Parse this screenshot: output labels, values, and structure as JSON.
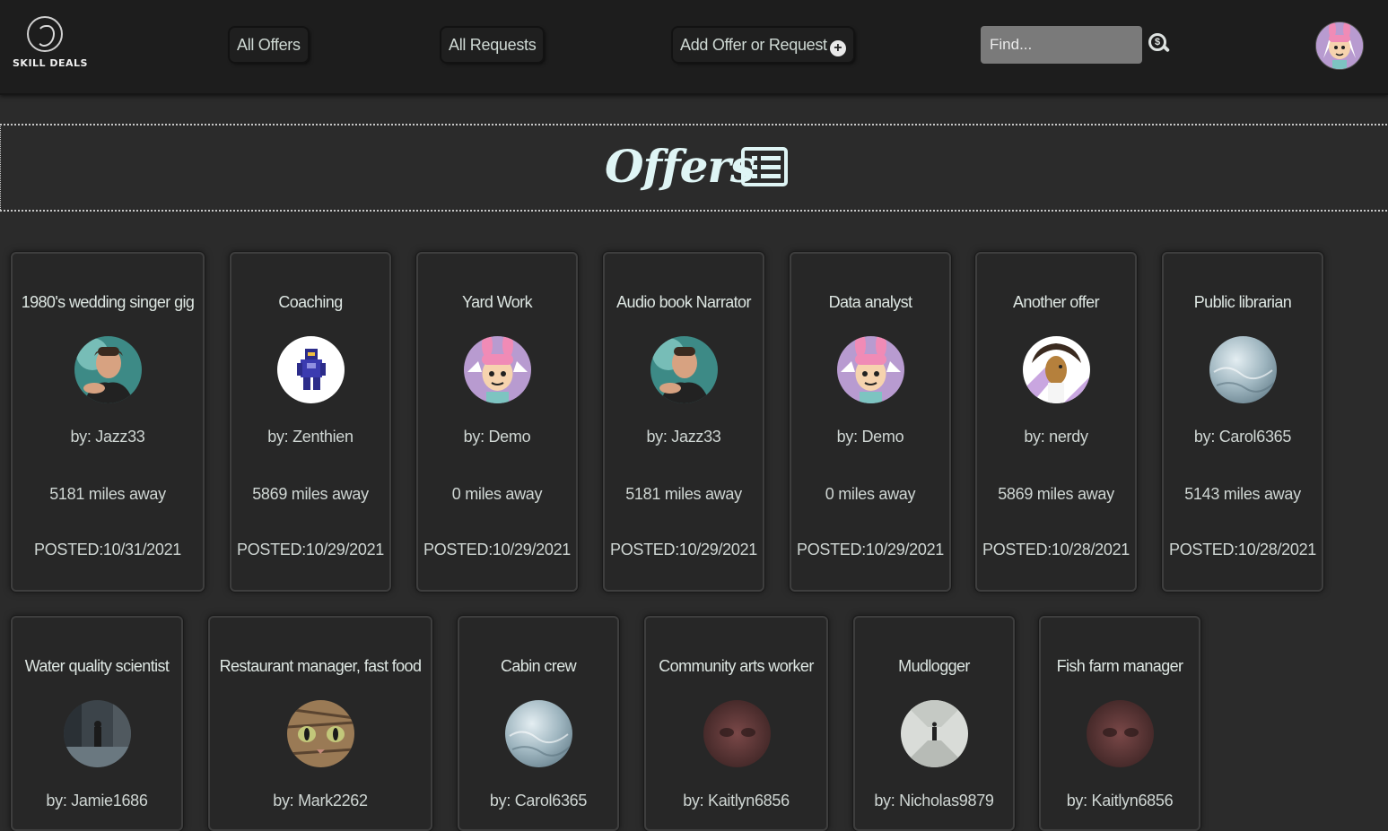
{
  "navbar": {
    "logo_text": "SKILL DEALS",
    "all_offers": "All Offers",
    "all_requests": "All Requests",
    "add_offer_request": "Add Offer or Request",
    "add_icon": "plus-circle-icon",
    "search_placeholder": "Find...",
    "search_icon": "dollar-search-icon"
  },
  "banner": {
    "title": "Offers",
    "icon": "list-icon"
  },
  "colors": {
    "background": "#2b2b2b",
    "navbar": "#1d1d1d",
    "card": "#272727",
    "banner_text": "#dff5f5",
    "search_field": "#7a7a7a"
  },
  "offers": [
    {
      "title": "1980's wedding singer gig",
      "by": "by: Jazz33",
      "distance": "5181 miles away",
      "posted": "POSTED:10/31/2021",
      "avatar": "man-portrait-avatar"
    },
    {
      "title": "Coaching",
      "by": "by: Zenthien",
      "distance": "5869 miles away",
      "posted": "POSTED:10/29/2021",
      "avatar": "pixel-knight-avatar"
    },
    {
      "title": "Yard Work",
      "by": "by: Demo",
      "distance": "0 miles away",
      "posted": "POSTED:10/29/2021",
      "avatar": "bunny-ears-girl-avatar"
    },
    {
      "title": "Audio book Narrator",
      "by": "by: Jazz33",
      "distance": "5181 miles away",
      "posted": "POSTED:10/29/2021",
      "avatar": "man-portrait-avatar"
    },
    {
      "title": "Data analyst",
      "by": "by: Demo",
      "distance": "0 miles away",
      "posted": "POSTED:10/29/2021",
      "avatar": "bunny-ears-girl-avatar"
    },
    {
      "title": "Another offer",
      "by": "by: nerdy",
      "distance": "5869 miles away",
      "posted": "POSTED:10/28/2021",
      "avatar": "cartoon-bird-avatar"
    },
    {
      "title": "Public librarian",
      "by": "by: Carol6365",
      "distance": "5143 miles away",
      "posted": "POSTED:10/28/2021",
      "avatar": "water-texture-avatar"
    },
    {
      "title": "Water quality scientist",
      "by": "by: Jamie1686",
      "distance": "",
      "posted": "",
      "avatar": "dark-room-avatar"
    },
    {
      "title": "Restaurant manager, fast food",
      "by": "by: Mark2262",
      "distance": "",
      "posted": "",
      "avatar": "cat-face-avatar"
    },
    {
      "title": "Cabin crew",
      "by": "by: Carol6365",
      "distance": "",
      "posted": "",
      "avatar": "water-texture-avatar"
    },
    {
      "title": "Community arts worker",
      "by": "by: Kaitlyn6856",
      "distance": "",
      "posted": "",
      "avatar": "blurred-face-avatar"
    },
    {
      "title": "Mudlogger",
      "by": "by: Nicholas9879",
      "distance": "",
      "posted": "",
      "avatar": "person-corridor-avatar"
    },
    {
      "title": "Fish farm manager",
      "by": "by: Kaitlyn6856",
      "distance": "",
      "posted": "",
      "avatar": "blurred-face-avatar"
    }
  ]
}
